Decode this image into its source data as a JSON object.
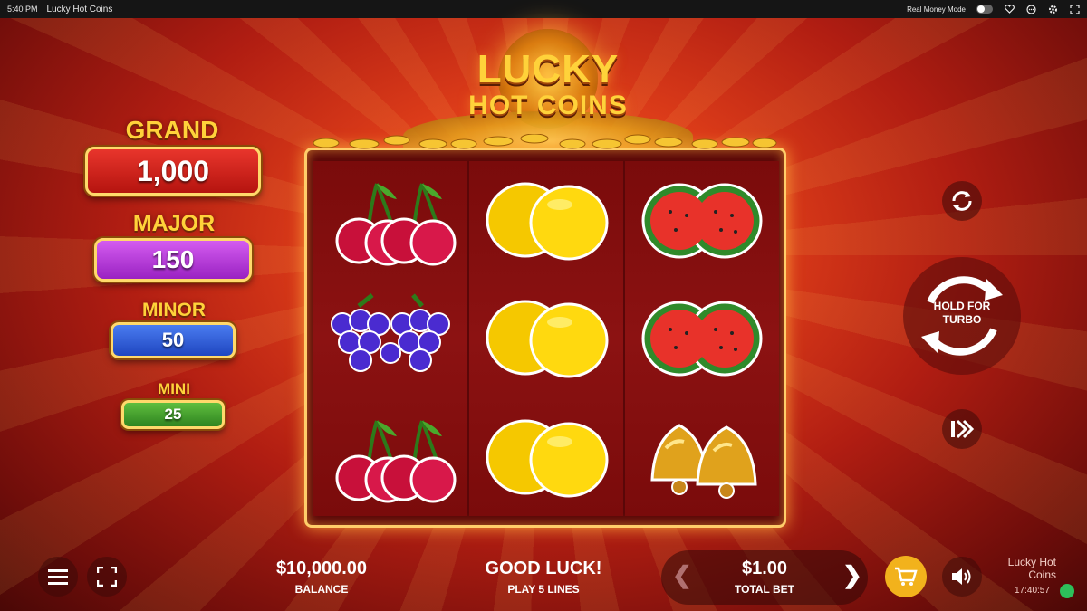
{
  "topbar": {
    "time": "5:40 PM",
    "title": "Lucky Hot Coins",
    "mode_label": "Real Money Mode",
    "icons": [
      "toggle-icon",
      "heart-icon",
      "chat-icon",
      "settings-icon",
      "expand-icon"
    ]
  },
  "logo": {
    "line1": "LUCKY",
    "line2": "HOT COINS"
  },
  "jackpots": [
    {
      "label": "GRAND",
      "value": "1,000",
      "color": "#d3201c"
    },
    {
      "label": "MAJOR",
      "value": "150",
      "color": "#b43ad9"
    },
    {
      "label": "MINOR",
      "value": "50",
      "color": "#2b59d9"
    },
    {
      "label": "MINI",
      "value": "25",
      "color": "#3f9a2c"
    }
  ],
  "reels": [
    [
      "cherries",
      "grapes",
      "cherries"
    ],
    [
      "lemons",
      "lemons",
      "lemons"
    ],
    [
      "watermelons",
      "watermelons",
      "bells"
    ]
  ],
  "controls": {
    "autoplay_icon": "autoplay-icon",
    "turbo_label": "HOLD FOR\nTURBO",
    "fast_icon": "fast-forward-icon"
  },
  "bottom": {
    "balance_value": "$10,000.00",
    "balance_label": "BALANCE",
    "message": "GOOD LUCK!",
    "lines_label": "PLAY 5 LINES",
    "bet_value": "$1.00",
    "bet_label": "TOTAL BET",
    "prev_arrow": "❮",
    "next_arrow": "❯",
    "brand_line1": "Lucky Hot",
    "brand_line2": "Coins",
    "clock": "17:40:57",
    "colors": {
      "shop": "#f2b21c"
    }
  }
}
